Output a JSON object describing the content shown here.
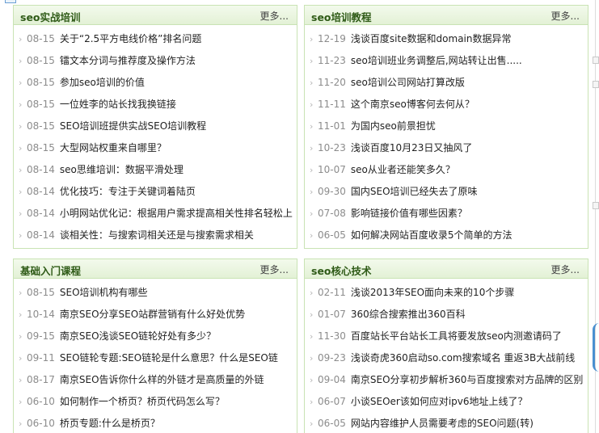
{
  "panels": [
    {
      "title": "seo实战培训",
      "more": "更多...",
      "items": [
        {
          "date": "08-15",
          "title": "关于“2.5平方电线价格”排名问题"
        },
        {
          "date": "08-15",
          "title": "镭文本分词与推荐度及操作方法"
        },
        {
          "date": "08-15",
          "title": "参加seo培训的价值"
        },
        {
          "date": "08-15",
          "title": "一位姓李的站长找我换链接"
        },
        {
          "date": "08-15",
          "title": "SEO培训班提供实战SEO培训教程"
        },
        {
          "date": "08-15",
          "title": "大型网站权重来自哪里？"
        },
        {
          "date": "08-14",
          "title": "seo思维培训：数据平滑处理"
        },
        {
          "date": "08-14",
          "title": "优化技巧：专注于关键词着陆页"
        },
        {
          "date": "08-14",
          "title": "小明网站优化记：根据用户需求提高相关性排名轻松上"
        },
        {
          "date": "08-14",
          "title": "谈相关性：与搜索词相关还是与搜索需求相关"
        }
      ]
    },
    {
      "title": "seo培训教程",
      "more": "更多...",
      "items": [
        {
          "date": "12-19",
          "title": "浅谈百度site数据和domain数据异常"
        },
        {
          "date": "11-23",
          "title": "seo培训班业务调整后,网站转让出售....."
        },
        {
          "date": "11-20",
          "title": "seo培训公司网站打算改版"
        },
        {
          "date": "11-11",
          "title": "这个南京seo博客何去何从？"
        },
        {
          "date": "11-01",
          "title": "为国内seo前景担忧"
        },
        {
          "date": "10-23",
          "title": "浅谈百度10月23日又抽风了"
        },
        {
          "date": "10-07",
          "title": "seo从业者还能笑多久？"
        },
        {
          "date": "09-30",
          "title": "国内SEO培训已经失去了原味"
        },
        {
          "date": "07-08",
          "title": "影响链接价值有哪些因素？"
        },
        {
          "date": "06-05",
          "title": "如何解决网站百度收录5个简单的方法"
        }
      ]
    },
    {
      "title": "基础入门课程",
      "more": "更多...",
      "items": [
        {
          "date": "08-15",
          "title": "SEO培训机构有哪些"
        },
        {
          "date": "10-14",
          "title": "南京SEO分享SEO站群营销有什么好处优势"
        },
        {
          "date": "09-15",
          "title": "南京SEO浅谈SEO链轮好处有多少？"
        },
        {
          "date": "09-11",
          "title": "SEO链轮专题:SEO链轮是什么意思？什么是SEO链"
        },
        {
          "date": "08-17",
          "title": "南京SEO告诉你什么样的外链才是高质量的外链"
        },
        {
          "date": "06-10",
          "title": "如何制作一个桥页？桥页代码怎么写？"
        },
        {
          "date": "06-10",
          "title": "桥页专题:什么是桥页？"
        }
      ]
    },
    {
      "title": "seo核心技术",
      "more": "更多...",
      "items": [
        {
          "date": "02-11",
          "title": "浅谈2013年SEO面向未来的10个步骤"
        },
        {
          "date": "01-07",
          "title": "360综合搜索推出360百科"
        },
        {
          "date": "11-30",
          "title": "百度站长平台站长工具将要发放seo内测邀请码了"
        },
        {
          "date": "09-23",
          "title": "浅谈奇虎360启动so.com搜索域名 重返3B大战前线"
        },
        {
          "date": "09-04",
          "title": "南京SEO分享初步解析360与百度搜索对方品牌的区别"
        },
        {
          "date": "06-07",
          "title": "小谈SEOer该如何应对ipv6地址上线了？"
        },
        {
          "date": "06-05",
          "title": "网站内容维护人员需要考虑的SEO问题(转)"
        }
      ]
    }
  ]
}
